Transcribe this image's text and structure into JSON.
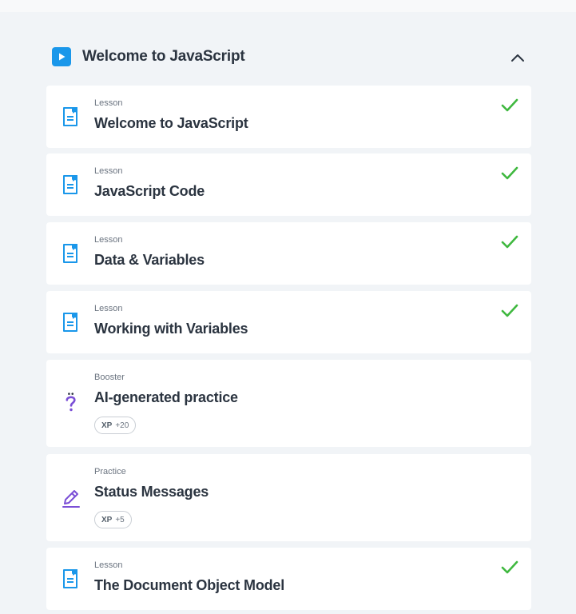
{
  "section": {
    "title": "Welcome to JavaScript",
    "collapse_icon": "chevron-up-icon"
  },
  "items": [
    {
      "kind": "Lesson",
      "title": "Welcome to JavaScript",
      "icon": "lesson-doc-icon",
      "completed": true
    },
    {
      "kind": "Lesson",
      "title": "JavaScript Code",
      "icon": "lesson-doc-icon",
      "completed": true
    },
    {
      "kind": "Lesson",
      "title": "Data & Variables",
      "icon": "lesson-doc-icon",
      "completed": true
    },
    {
      "kind": "Lesson",
      "title": "Working with Variables",
      "icon": "lesson-doc-icon",
      "completed": true
    },
    {
      "kind": "Booster",
      "title": "AI-generated practice",
      "icon": "question-sparkle-icon",
      "completed": false,
      "xp_label": "XP",
      "xp_value": "+20"
    },
    {
      "kind": "Practice",
      "title": "Status Messages",
      "icon": "pencil-icon",
      "completed": false,
      "xp_label": "XP",
      "xp_value": "+5"
    },
    {
      "kind": "Lesson",
      "title": "The Document Object Model",
      "icon": "lesson-doc-icon",
      "completed": true
    }
  ],
  "colors": {
    "accent": "#1a97ea",
    "check": "#3fb83f",
    "booster": "#7b4fd6",
    "background": "#f1f4f7"
  }
}
